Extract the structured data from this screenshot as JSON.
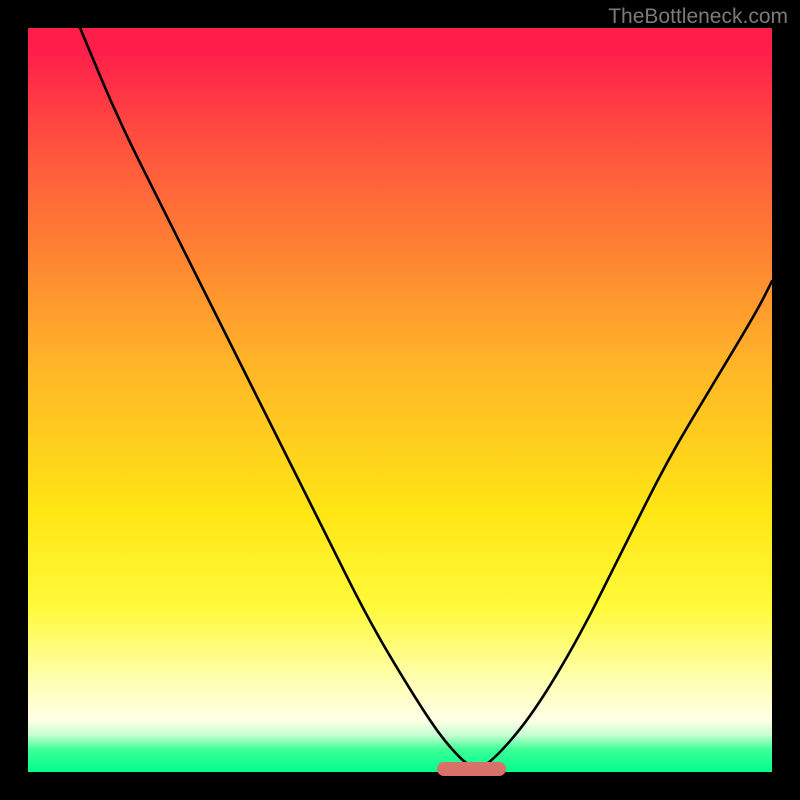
{
  "watermark": "TheBottleneck.com",
  "marker": {
    "left_pct": 55,
    "width_pct": 9.2,
    "color": "#d9716b"
  },
  "chart_data": {
    "type": "line",
    "title": "",
    "xlabel": "",
    "ylabel": "",
    "xlim": [
      0,
      100
    ],
    "ylim": [
      0,
      100
    ],
    "grid": false,
    "legend": false,
    "series": [
      {
        "name": "curve",
        "x": [
          7,
          12,
          18,
          24,
          28,
          34,
          40,
          46,
          52,
          56,
          60,
          63,
          68,
          74,
          80,
          86,
          92,
          98,
          100
        ],
        "y": [
          100,
          88,
          76,
          64,
          56,
          44,
          32,
          20,
          10,
          4,
          0,
          2,
          8,
          18,
          30,
          42,
          52,
          62,
          66
        ]
      }
    ],
    "gradient_stops": [
      {
        "pct": 0,
        "color": "#ff1e4a"
      },
      {
        "pct": 18,
        "color": "#ff5a3c"
      },
      {
        "pct": 45,
        "color": "#ffb428"
      },
      {
        "pct": 78,
        "color": "#fffa3c"
      },
      {
        "pct": 93,
        "color": "#ffffe6"
      },
      {
        "pct": 100,
        "color": "#00ff8c"
      }
    ]
  }
}
